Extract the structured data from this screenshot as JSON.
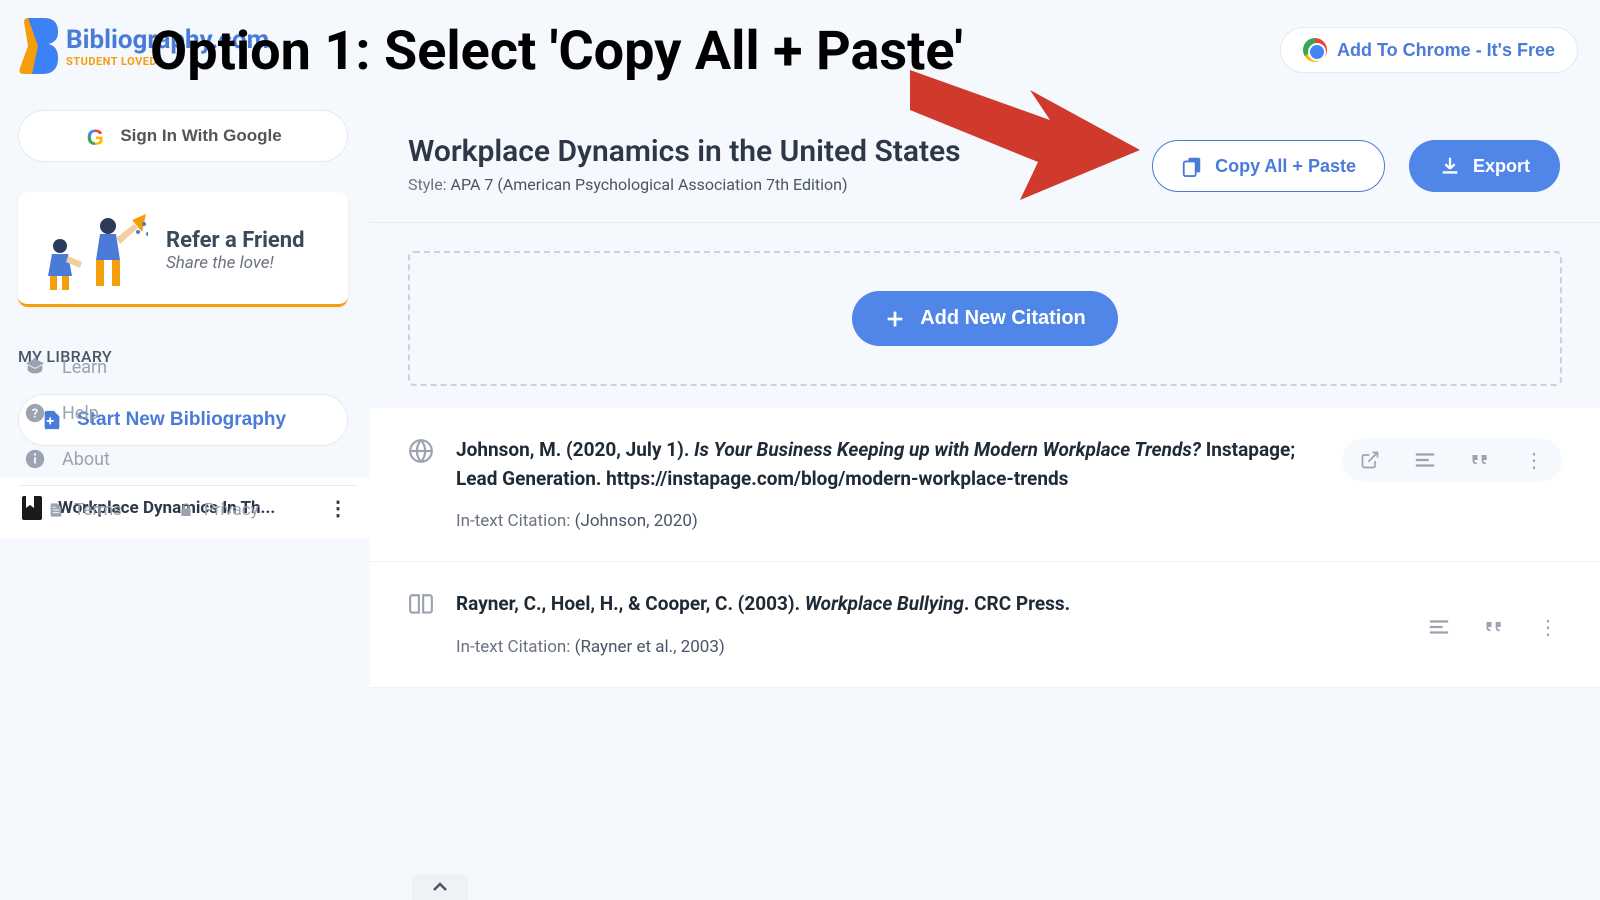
{
  "overlay": {
    "title": "Option 1: Select 'Copy All + Paste'"
  },
  "logo": {
    "brand": "Bibliography.com",
    "tagline": "STUDENT LOVED"
  },
  "chrome_cta": {
    "label": "Add To Chrome - It's Free"
  },
  "sidebar": {
    "signin_label": "Sign In With Google",
    "refer": {
      "title": "Refer a Friend",
      "subtitle": "Share the love!"
    },
    "library_heading": "MY LIBRARY",
    "new_bib_label": "Start New Bibliography",
    "library_item": "Workplace Dynamics In Th...",
    "nav": {
      "learn": "Learn",
      "help": "Help",
      "about": "About"
    },
    "footer": {
      "terms": "Terms",
      "privacy": "Privacy"
    }
  },
  "main": {
    "title": "Workplace Dynamics in the United States",
    "style_label": "Style: ",
    "style_value": "APA 7 (American Psychological Association 7th Edition)",
    "copy_label": "Copy All + Paste",
    "export_label": "Export",
    "add_label": "Add New Citation"
  },
  "citations": [
    {
      "type": "web",
      "prefix": "Johnson, M. (2020, July 1). ",
      "italic": "Is Your Business Keeping up with Modern Workplace Trends?",
      "suffix": " Instapage; Lead Generation. https://instapage.com/blog/modern-workplace-trends",
      "intext_label": "In-text Citation:",
      "intext_value": "(Johnson, 2020)",
      "show_open": true
    },
    {
      "type": "book",
      "prefix": "Rayner, C., Hoel, H., & Cooper, C. (2003). ",
      "italic": "Workplace Bullying",
      "suffix": ". CRC Press.",
      "intext_label": "In-text Citation:",
      "intext_value": "(Rayner et al., 2003)",
      "show_open": false
    }
  ]
}
